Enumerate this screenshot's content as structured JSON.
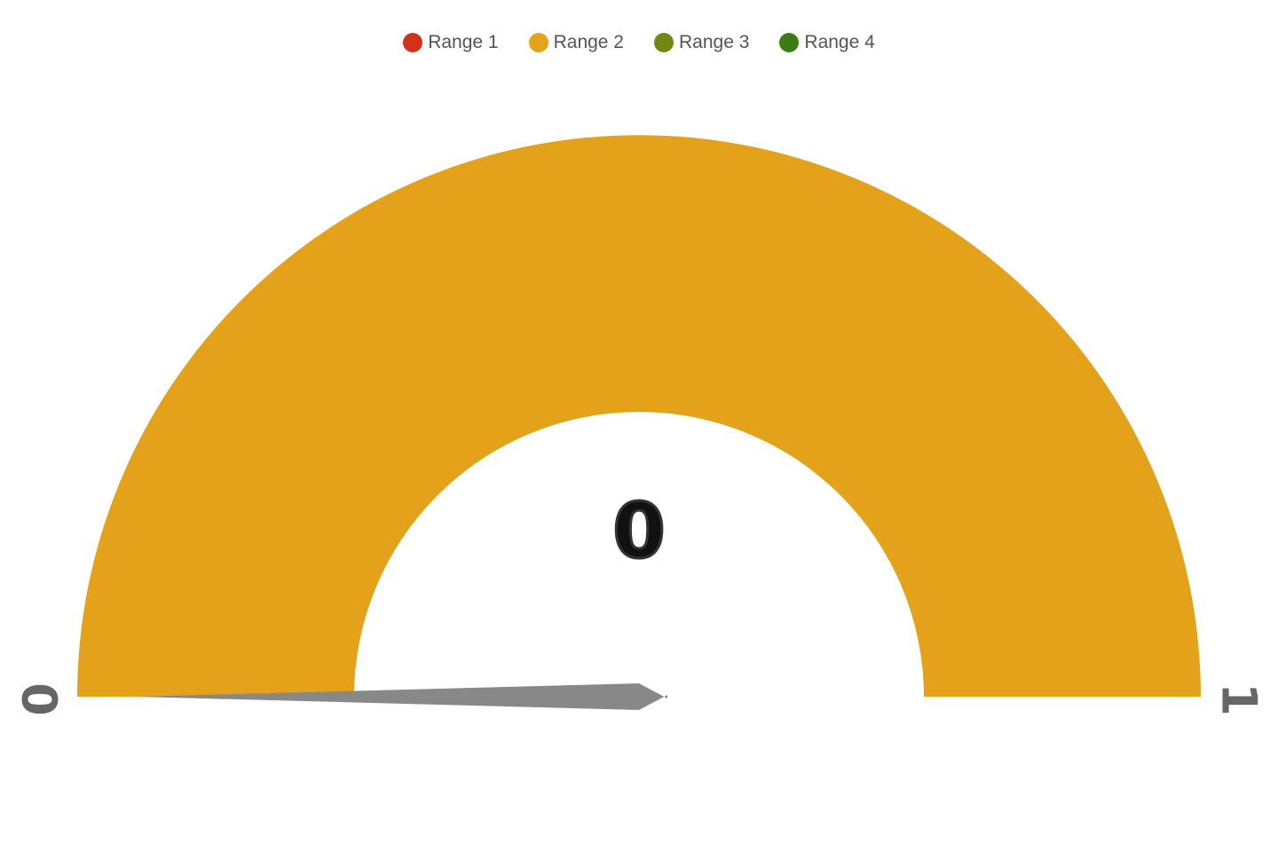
{
  "chart_data": {
    "type": "gauge",
    "min": 0,
    "max": 1,
    "value": 0,
    "value_label": "0",
    "min_label": "0",
    "max_label": "1",
    "legend": [
      {
        "name": "Range 1",
        "color": "#d0321b"
      },
      {
        "name": "Range 2",
        "color": "#e3a21a"
      },
      {
        "name": "Range 3",
        "color": "#6f8a12"
      },
      {
        "name": "Range 4",
        "color": "#3b7d13"
      }
    ],
    "bands": [
      {
        "range": "Range 2",
        "from": 0,
        "to": 1,
        "color": "#e3a21a"
      }
    ],
    "needle_color": "#888888",
    "label_color": "#666666"
  }
}
